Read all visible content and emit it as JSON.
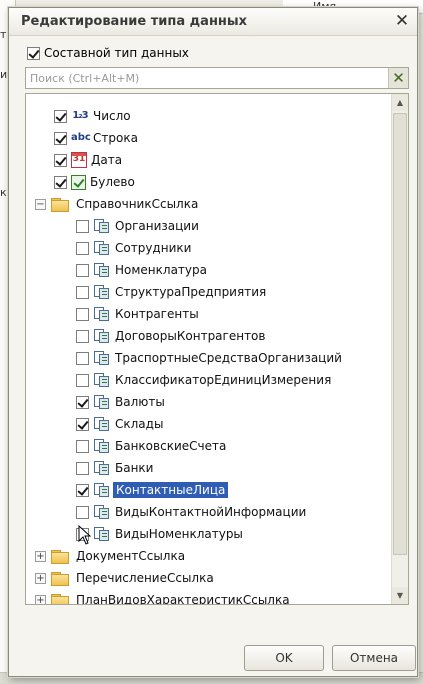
{
  "background": {
    "left_fragments": [
      "ть",
      "ити",
      "к:"
    ],
    "top_right_fragment": "Имя"
  },
  "dialog": {
    "title": "Редактирование типа данных",
    "close_glyph": "✕",
    "composite_label": "Составной тип данных",
    "composite_checked": true,
    "search_placeholder": "Поиск (Ctrl+Alt+M)",
    "search_value": "",
    "search_clear_glyph": "✕",
    "ok_label": "OK",
    "cancel_label": "Отмена"
  },
  "tree": {
    "primitives": [
      {
        "label": "Число",
        "checked": true,
        "icon": "number-icon",
        "glyph": "1₂3"
      },
      {
        "label": "Строка",
        "checked": true,
        "icon": "string-icon",
        "glyph": "abc"
      },
      {
        "label": "Дата",
        "checked": true,
        "icon": "date-icon",
        "glyph": "31"
      },
      {
        "label": "Булево",
        "checked": true,
        "icon": "boolean-icon",
        "glyph": ""
      }
    ],
    "group_catalogs": {
      "label": "СправочникСсылка",
      "expanded": true,
      "expander": "−"
    },
    "catalogs": [
      {
        "label": "Организации",
        "checked": false
      },
      {
        "label": "Сотрудники",
        "checked": false
      },
      {
        "label": "Номенклатура",
        "checked": false
      },
      {
        "label": "СтруктураПредприятия",
        "checked": false
      },
      {
        "label": "Контрагенты",
        "checked": false
      },
      {
        "label": "ДоговорыКонтрагентов",
        "checked": false
      },
      {
        "label": "ТраспортныеСредстваОрганизаций",
        "checked": false
      },
      {
        "label": "КлассификаторЕдиницИзмерения",
        "checked": false
      },
      {
        "label": "Валюты",
        "checked": true
      },
      {
        "label": "Склады",
        "checked": true
      },
      {
        "label": "БанковскиеСчета",
        "checked": false
      },
      {
        "label": "Банки",
        "checked": false
      },
      {
        "label": "КонтактныеЛица",
        "checked": true,
        "selected": true
      },
      {
        "label": "ВидыКонтактнойИнформации",
        "checked": false
      },
      {
        "label": "ВидыНоменклатуры",
        "checked": false
      }
    ],
    "other_groups": [
      {
        "label": "ДокументСсылка",
        "expander": "+"
      },
      {
        "label": "ПеречислениеСсылка",
        "expander": "+"
      },
      {
        "label": "ПланВидовХарактеристикСсылка",
        "expander": "+"
      }
    ]
  },
  "scrollbar": {
    "up_glyph": "▲",
    "down_glyph": "▼"
  }
}
